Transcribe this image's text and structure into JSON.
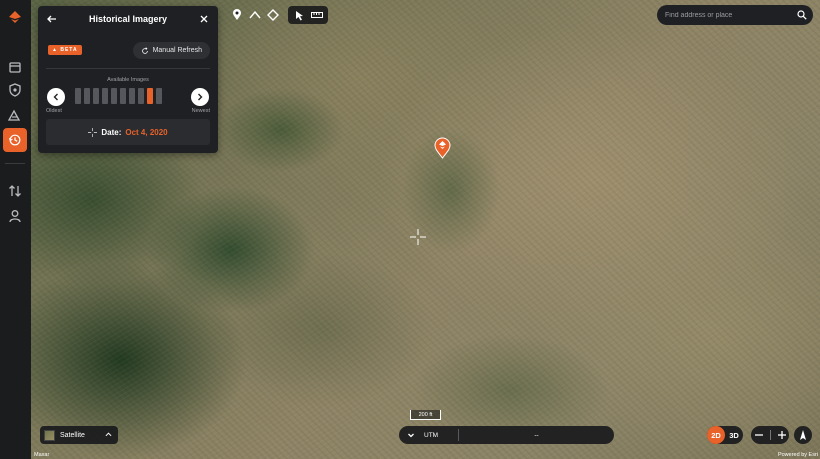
{
  "panel": {
    "title": "Historical Imagery",
    "badge": "BETA",
    "refresh_label": "Manual Refresh",
    "available_label": "Available Images",
    "oldest_label": "Oldest",
    "newest_label": "Newest",
    "image_count": 10,
    "selected_index": 8,
    "date_label": "Date:",
    "date_value": "Oct 4, 2020"
  },
  "search": {
    "placeholder": "Find address or place"
  },
  "layer": {
    "label": "Satellite"
  },
  "scale": {
    "label": "200 ft"
  },
  "coords": {
    "system": "UTM",
    "value": "--"
  },
  "view_mode": {
    "options": [
      "2D",
      "3D"
    ],
    "selected": "2D"
  },
  "attribution": {
    "left": "Maxar",
    "right": "Powered by Esri"
  },
  "colors": {
    "accent": "#e8622a",
    "panel": "#1f2023",
    "rail": "#1b1c1e"
  },
  "icons": {
    "rail": [
      "logo-icon",
      "calendar-icon",
      "shield-icon",
      "terrain-icon",
      "history-icon",
      "transfer-icon",
      "user-icon"
    ],
    "tools": [
      "pin-icon",
      "line-icon",
      "area-icon",
      "pointer-icon",
      "ruler-icon"
    ]
  }
}
